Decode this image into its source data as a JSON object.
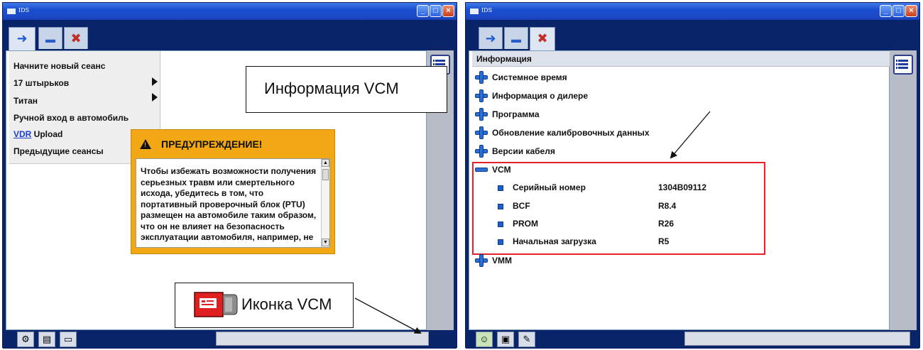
{
  "window_title": "IDS",
  "left": {
    "menu_items": [
      {
        "label": "Начните новый сеанс",
        "has_submenu": false
      },
      {
        "label": "17 штырьков",
        "has_submenu": true
      },
      {
        "label": "Титан",
        "has_submenu": true
      },
      {
        "label": "Ручной вход в автомобиль",
        "has_submenu": false
      },
      {
        "label_link": "VDR",
        "label_rest": " Upload",
        "has_submenu": false
      },
      {
        "label": "Предыдущие сеансы",
        "has_submenu": false
      }
    ],
    "warning": {
      "title": "ПРЕДУПРЕЖДЕНИЕ!",
      "text": "Чтобы избежать возможности получения серьезных травм или смертельного исхода, убедитесь в том, что портативный проверочный блок (PTU) размещен на автомобиле таким образом, что он не влияет на безопасность эксплуатации автомобиля, например, не"
    },
    "callout": "Иконка VCM"
  },
  "right": {
    "section_title": "Информация",
    "items": [
      "Системное время",
      "Информация о дилере",
      "Программа",
      "Обновление калибровочных данных",
      "Версии кабеля"
    ],
    "vcm": {
      "label": "VCM",
      "rows": [
        {
          "name": "Серийный номер",
          "value": "1304B09112"
        },
        {
          "name": "BCF",
          "value": "R8.4"
        },
        {
          "name": "PROM",
          "value": "R26"
        },
        {
          "name": "Начальная загрузка",
          "value": "R5"
        }
      ]
    },
    "vmm_label": "VMM",
    "callout": "Информация VCM"
  },
  "colors": {
    "title_bar": "#1a4fd0",
    "frame": "#0a246a",
    "warning": "#f1a814",
    "highlight_frame": "#e8202a",
    "tree_icon": "#2a6fd6"
  },
  "icons": [
    "back-arrow-icon",
    "vehicle-icon",
    "toolbox-icon",
    "list-icon",
    "vcm-device-icon",
    "plus-icon",
    "minus-icon",
    "bullet-icon"
  ]
}
